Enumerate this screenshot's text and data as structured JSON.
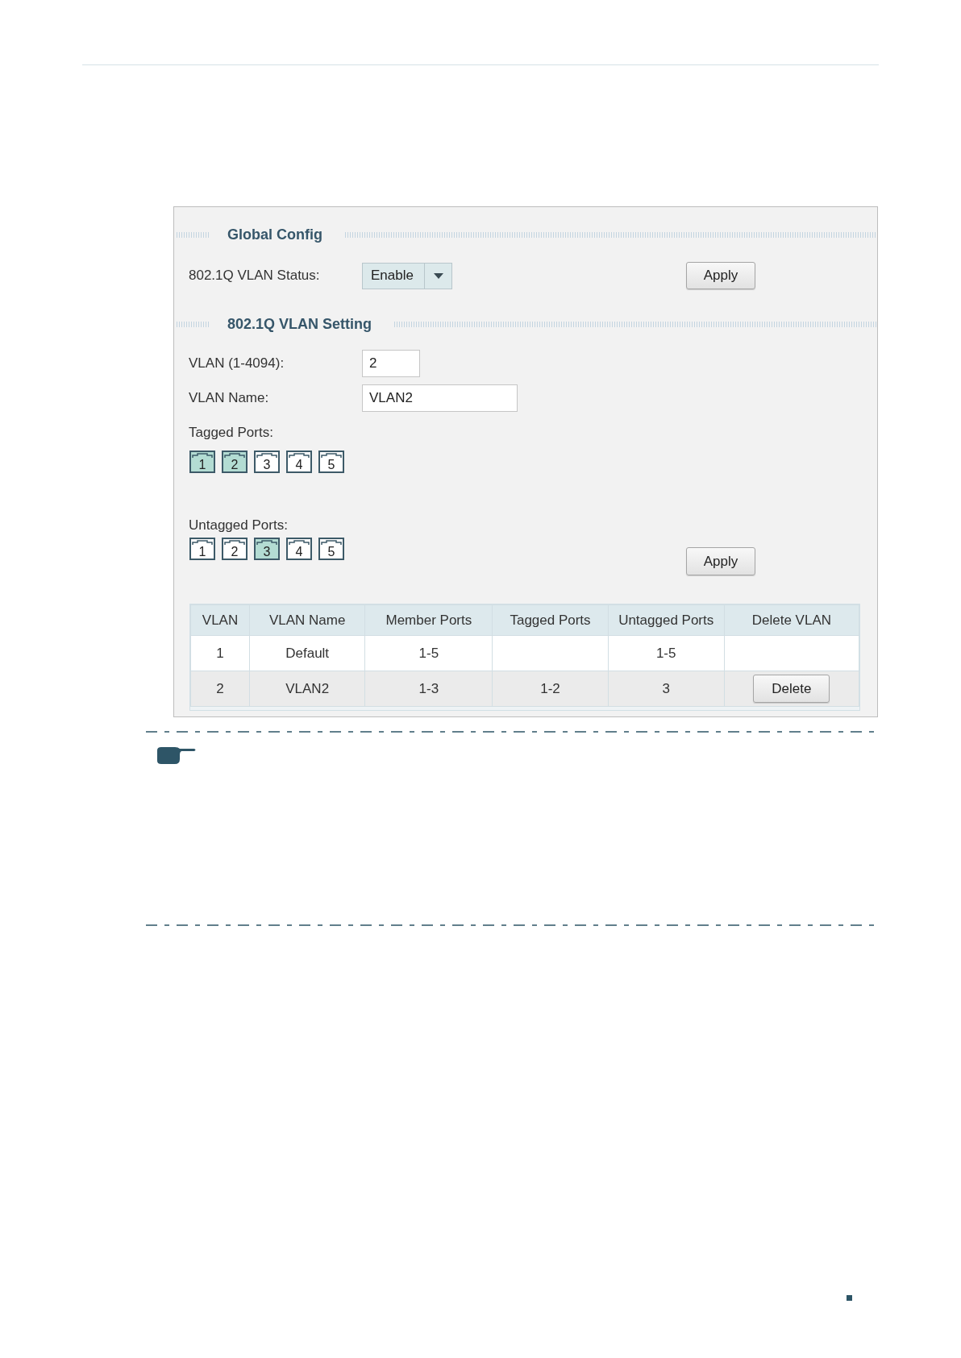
{
  "panel": {
    "global_config": {
      "title": "Global Config",
      "status": {
        "label": "802.1Q VLAN Status:",
        "value": "Enable"
      },
      "apply_button": "Apply"
    },
    "vlan_setting": {
      "title": "802.1Q VLAN Setting",
      "vlan_id": {
        "label": "VLAN (1-4094):",
        "value": "2"
      },
      "vlan_name": {
        "label": "VLAN Name:",
        "value": "VLAN2"
      },
      "tagged_ports": {
        "label": "Tagged Ports:",
        "ports": [
          {
            "label": "1",
            "selected": true
          },
          {
            "label": "2",
            "selected": true
          },
          {
            "label": "3",
            "selected": false
          },
          {
            "label": "4",
            "selected": false
          },
          {
            "label": "5",
            "selected": false
          }
        ]
      },
      "untagged_ports": {
        "label": "Untagged Ports:",
        "ports": [
          {
            "label": "1",
            "selected": false
          },
          {
            "label": "2",
            "selected": false
          },
          {
            "label": "3",
            "selected": true
          },
          {
            "label": "4",
            "selected": false
          },
          {
            "label": "5",
            "selected": false
          }
        ]
      },
      "apply_button": "Apply"
    },
    "vlan_table": {
      "columns": [
        "VLAN",
        "VLAN Name",
        "Member Ports",
        "Tagged Ports",
        "Untagged Ports",
        "Delete VLAN"
      ],
      "rows": [
        {
          "vlan": "1",
          "vlan_name": "Default",
          "member_ports": "1-5",
          "untagged_ports": "1-5"
        },
        {
          "vlan": "2",
          "vlan_name": "VLAN2",
          "member_ports": "1-3",
          "tagged_ports": "1-2",
          "untagged_ports": "3",
          "delete_button": "Delete"
        }
      ]
    }
  }
}
